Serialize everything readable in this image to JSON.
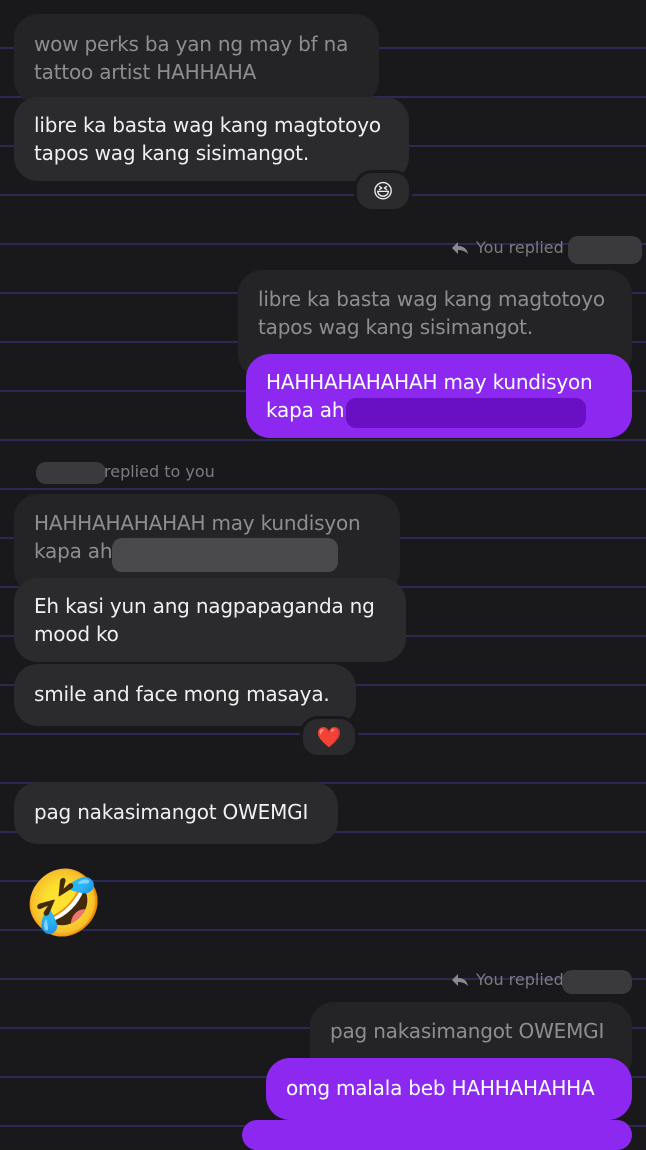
{
  "messages": {
    "m1": "wow perks ba yan ng may bf na tattoo artist HAHHAHA",
    "m2": "libre ka basta wag kang magtotoyo tapos wag kang sisimangot.",
    "m2_reaction": "😆",
    "reply1_label": "You replied to",
    "m3_quote": "libre ka basta wag kang magtotoyo tapos wag kang sisimangot.",
    "m3": "HAHHAHAHAHAH may kundisyon kapa ah",
    "reply2_label": "replied to you",
    "m4_quote": "HAHHAHAHAHAH may kundisyon kapa ah",
    "m4": "Eh kasi yun ang nagpapaganda ng mood ko",
    "m5": "smile and face mong masaya.",
    "m5_reaction": "❤️",
    "m6": "pag nakasimangot OWEMGI",
    "m7": "🤣",
    "reply3_label": "You replied to",
    "m8_quote": "pag nakasimangot OWEMGI",
    "m8": "omg malala beb HAHHAHAHHA"
  },
  "colors": {
    "background": "#19191b",
    "line": "#2b2a55",
    "incoming": "#2b2b2d",
    "outgoing": "#8d28f0"
  }
}
